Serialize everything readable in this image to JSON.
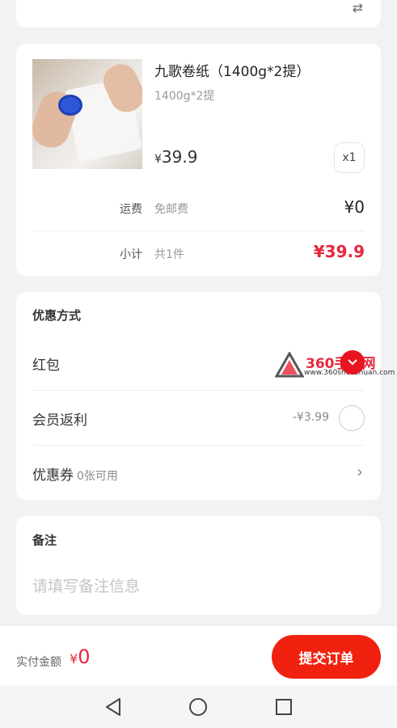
{
  "address": {
    "swap_icon": "swap-arrows-icon"
  },
  "product": {
    "title": "九歌卷纸（1400g*2提）",
    "spec": "1400g*2提",
    "price_currency": "¥",
    "price": "39.9",
    "quantity": "x1",
    "shipping_label": "运费",
    "shipping_value": "免邮费",
    "shipping_amount": "¥0",
    "subtotal_label": "小计",
    "subtotal_count": "共1件",
    "subtotal_amount": "¥39.9"
  },
  "discount": {
    "title": "优惠方式",
    "red_packet_label": "红包",
    "member_label": "会员返利",
    "member_amount": "-¥3.99",
    "coupon_label": "优惠券",
    "coupon_available": "0张可用"
  },
  "watermark": {
    "text": "360手游网",
    "url": "www.360shouzhuan.com"
  },
  "remark": {
    "title": "备注",
    "placeholder": "请填写备注信息"
  },
  "footer": {
    "pay_label": "实付金额",
    "pay_currency": "¥",
    "pay_amount": "0",
    "submit_label": "提交订单"
  },
  "colors": {
    "accent": "#e8263b",
    "submit": "#f0220f"
  }
}
